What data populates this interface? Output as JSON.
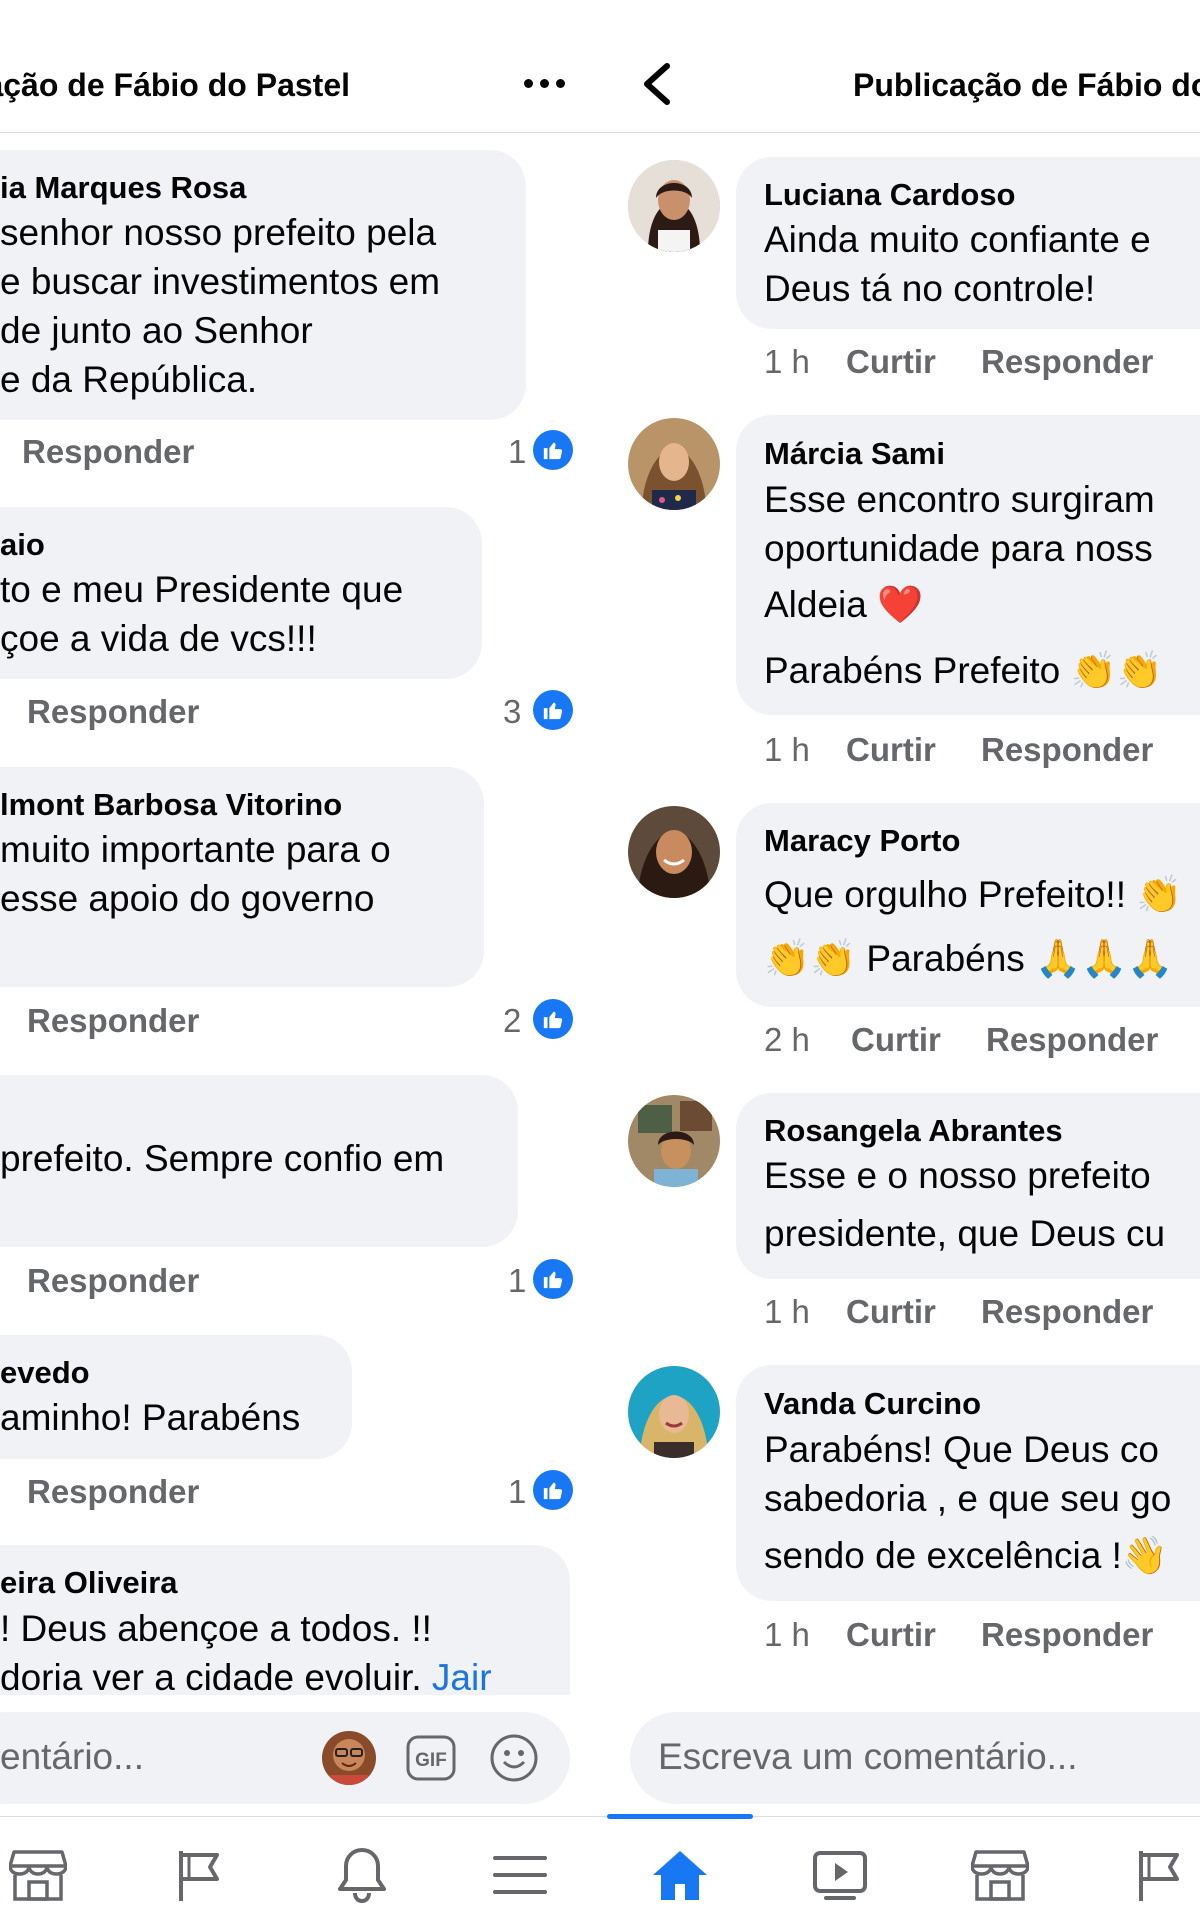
{
  "left_pane": {
    "header_title": "ação de Fábio do Pastel",
    "comments": [
      {
        "name": "ia Marques Rosa",
        "lines": [
          "senhor nosso prefeito pela",
          "e buscar investimentos em",
          "de junto ao Senhor",
          "e da República."
        ],
        "reply": "Responder",
        "reactions": "1"
      },
      {
        "name": "aio",
        "lines": [
          "to e meu Presidente que",
          "çoe a vida de vcs!!!"
        ],
        "reply": "Responder",
        "reactions": "3"
      },
      {
        "name": "lmont Barbosa Vitorino",
        "lines": [
          " muito importante para o",
          "esse apoio do governo"
        ],
        "reply": "Responder",
        "reactions": "2"
      },
      {
        "name": "",
        "lines": [
          "prefeito. Sempre confio em"
        ],
        "reply": "Responder",
        "reactions": "1"
      },
      {
        "name": "evedo",
        "lines": [
          "aminho! Parabéns"
        ],
        "reply": "Responder",
        "reactions": "1"
      },
      {
        "name": "eira Oliveira",
        "lines": [
          "! Deus abençoe a todos. !!",
          "doria ver a cidade evoluir. "
        ],
        "link": "Jair"
      }
    ],
    "comment_placeholder": "entário..."
  },
  "right_pane": {
    "header_title": "Publicação de Fábio do",
    "comments": [
      {
        "name": "Luciana Cardoso",
        "lines": [
          "Ainda muito confiante e",
          "Deus tá no controle!"
        ],
        "time": "1 h",
        "like": "Curtir",
        "reply": "Responder"
      },
      {
        "name": "Márcia Sami",
        "lines": [
          "Esse encontro surgiram",
          "oportunidade para noss",
          "Aldeia ❤️",
          "Parabéns Prefeito 👏👏"
        ],
        "time": "1 h",
        "like": "Curtir",
        "reply": "Responder"
      },
      {
        "name": "Maracy Porto",
        "lines": [
          "Que orgulho Prefeito!! 👏",
          "👏👏 Parabéns 🙏🙏🙏"
        ],
        "time": "2 h",
        "like": "Curtir",
        "reply": "Responder"
      },
      {
        "name": "Rosangela Abrantes",
        "lines": [
          "Esse e o nosso prefeito",
          "presidente, que Deus cu"
        ],
        "time": "1 h",
        "like": "Curtir",
        "reply": "Responder"
      },
      {
        "name": "Vanda Curcino",
        "lines": [
          "Parabéns! Que Deus co",
          "sabedoria , e que seu go",
          "sendo de excelência !👋"
        ],
        "time": "1 h",
        "like": "Curtir",
        "reply": "Responder"
      }
    ],
    "comment_placeholder": "Escreva um comentário..."
  },
  "icons": {
    "back": "chevron-left-icon",
    "more": "more-horizontal-icon",
    "like": "like-thumb-icon",
    "gif": "gif-icon",
    "emoji": "smiley-icon",
    "nav": [
      "marketplace-icon",
      "pages-flag-icon",
      "notifications-bell-icon",
      "menu-icon",
      "home-icon",
      "watch-video-icon",
      "marketplace-icon",
      "pages-flag-icon"
    ]
  },
  "colors": {
    "accent": "#1877f2",
    "bubble": "#f0f2f5",
    "muted_text": "#65676b",
    "link": "#1b74e4"
  }
}
